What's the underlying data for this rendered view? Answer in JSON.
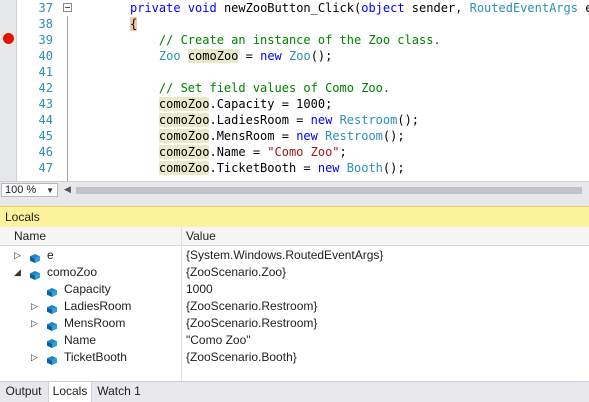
{
  "editor": {
    "lines": [
      {
        "n": "37",
        "parts": [
          [
            "kw",
            "private"
          ],
          [
            "tx",
            " "
          ],
          [
            "kw",
            "void"
          ],
          [
            "tx",
            " newZooButton_Click("
          ],
          [
            "kw",
            "object"
          ],
          [
            "tx",
            " sender, "
          ],
          [
            "ty",
            "RoutedEventArgs"
          ],
          [
            "tx",
            " e)"
          ]
        ]
      },
      {
        "n": "38",
        "parts": [
          [
            "brace",
            "{"
          ]
        ]
      },
      {
        "n": "39",
        "parts": [
          [
            "cm",
            "    // Create an instance of the Zoo class."
          ]
        ]
      },
      {
        "n": "40",
        "parts": [
          [
            "tx",
            "    "
          ],
          [
            "ty",
            "Zoo"
          ],
          [
            "tx",
            " "
          ],
          [
            "hl",
            "comoZoo"
          ],
          [
            "tx",
            " = "
          ],
          [
            "kw",
            "new"
          ],
          [
            "tx",
            " "
          ],
          [
            "ty",
            "Zoo"
          ],
          [
            "tx",
            "();"
          ]
        ]
      },
      {
        "n": "41",
        "parts": []
      },
      {
        "n": "42",
        "parts": [
          [
            "cm",
            "    // Set field values of Como Zoo."
          ]
        ]
      },
      {
        "n": "43",
        "parts": [
          [
            "tx",
            "    "
          ],
          [
            "hl",
            "comoZoo"
          ],
          [
            "tx",
            ".Capacity = 1000;"
          ]
        ]
      },
      {
        "n": "44",
        "parts": [
          [
            "tx",
            "    "
          ],
          [
            "hl",
            "comoZoo"
          ],
          [
            "tx",
            ".LadiesRoom = "
          ],
          [
            "kw",
            "new"
          ],
          [
            "tx",
            " "
          ],
          [
            "ty",
            "Restroom"
          ],
          [
            "tx",
            "();"
          ]
        ]
      },
      {
        "n": "45",
        "parts": [
          [
            "tx",
            "    "
          ],
          [
            "hl",
            "comoZoo"
          ],
          [
            "tx",
            ".MensRoom = "
          ],
          [
            "kw",
            "new"
          ],
          [
            "tx",
            " "
          ],
          [
            "ty",
            "Restroom"
          ],
          [
            "tx",
            "();"
          ]
        ]
      },
      {
        "n": "46",
        "parts": [
          [
            "tx",
            "    "
          ],
          [
            "hl",
            "comoZoo"
          ],
          [
            "tx",
            ".Name = "
          ],
          [
            "st",
            "\"Como Zoo\""
          ],
          [
            "tx",
            ";"
          ]
        ]
      },
      {
        "n": "47",
        "parts": [
          [
            "tx",
            "    "
          ],
          [
            "hl",
            "comoZoo"
          ],
          [
            "tx",
            ".TicketBooth = "
          ],
          [
            "kw",
            "new"
          ],
          [
            "tx",
            " "
          ],
          [
            "ty",
            "Booth"
          ],
          [
            "tx",
            "();"
          ]
        ]
      }
    ],
    "breakpoint_line": "38"
  },
  "zoom": {
    "value": "100 %"
  },
  "locals": {
    "title": "Locals",
    "col_name": "Name",
    "col_value": "Value",
    "rows": [
      {
        "name": "e",
        "value": "{System.Windows.RoutedEventArgs}",
        "level": 0,
        "expander": "collapsed"
      },
      {
        "name": "comoZoo",
        "value": "{ZooScenario.Zoo}",
        "level": 0,
        "expander": "expanded"
      },
      {
        "name": "Capacity",
        "value": "1000",
        "level": 1,
        "expander": "none"
      },
      {
        "name": "LadiesRoom",
        "value": "{ZooScenario.Restroom}",
        "level": 1,
        "expander": "collapsed"
      },
      {
        "name": "MensRoom",
        "value": "{ZooScenario.Restroom}",
        "level": 1,
        "expander": "collapsed"
      },
      {
        "name": "Name",
        "value": "\"Como Zoo\"",
        "level": 1,
        "expander": "none"
      },
      {
        "name": "TicketBooth",
        "value": "{ZooScenario.Booth}",
        "level": 1,
        "expander": "collapsed"
      }
    ]
  },
  "tabs": [
    {
      "label": "Output",
      "active": false
    },
    {
      "label": "Locals",
      "active": true
    },
    {
      "label": "Watch 1",
      "active": false
    }
  ],
  "colors": {
    "breakpoint": "#e51400",
    "locals_title_bg": "#fff29d",
    "keyword": "#0000ff",
    "type": "#2b91af",
    "comment": "#008000",
    "string": "#a31515"
  },
  "icons": {
    "variable": "cube-icon",
    "expand": "triangle-right-icon",
    "collapse": "triangle-down-icon"
  }
}
